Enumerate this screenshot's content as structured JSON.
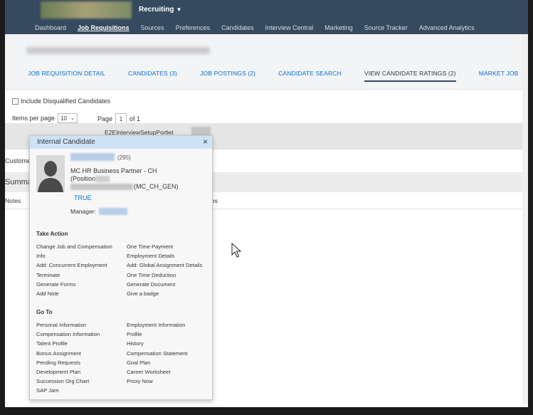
{
  "header": {
    "module": "Recruiting",
    "nav": [
      "Dashboard",
      "Job Requisitions",
      "Sources",
      "Preferences",
      "Candidates",
      "Interview Central",
      "Marketing",
      "Source Tracker",
      "Advanced Analytics"
    ]
  },
  "tabs": [
    "JOB REQUISITION DETAIL",
    "CANDIDATES (3)",
    "JOB POSTINGS (2)",
    "CANDIDATE SEARCH",
    "VIEW CANDIDATE RATINGS (2)",
    "MARKET JOB"
  ],
  "filters": {
    "include_disqualified": "Include Disqualified Candidates",
    "items_per_page_label": "Items per page",
    "items_per_page_value": "10",
    "page_label": "Page",
    "page_value": "1",
    "of_label": "of 1"
  },
  "grid": {
    "portlet": "E2EInterviewSetupPortlet",
    "customer_label": "Custome",
    "summary_label": "Summa",
    "notes_label": "Notes",
    "notes_right": "es"
  },
  "popup": {
    "title": "Internal Candidate",
    "close": "×",
    "count": "(295)",
    "job_title": "MC HR Business Partner - CH",
    "position_label": "(Position",
    "mc_suffix": "(MC_CH_GEN)",
    "true_link": "TRUE",
    "manager_label": "Manager:",
    "take_action_title": "Take Action",
    "take_action_left": [
      "Change Job and Compensation",
      "Info",
      "Add: Concurrent Employment",
      "Terminate",
      "Generate Forms",
      "Add Note"
    ],
    "take_action_right": [
      "One Time Payment",
      "Employment Details",
      "Add: Global Assignment Details",
      "One Time Deduction",
      "Generate Document",
      "Give a badge"
    ],
    "goto_title": "Go To",
    "goto_left": [
      "Personal Information",
      "Compensation Information",
      "Talent Profile",
      "Bonus Assignment",
      "Pending Requests",
      "Development Plan",
      "Succession Org Chart",
      "SAP Jam"
    ],
    "goto_right": [
      "Employment Information",
      "Profile",
      "History",
      "Compensation Statement",
      "Goal Plan",
      "Career Worksheet",
      "Proxy Now"
    ]
  }
}
